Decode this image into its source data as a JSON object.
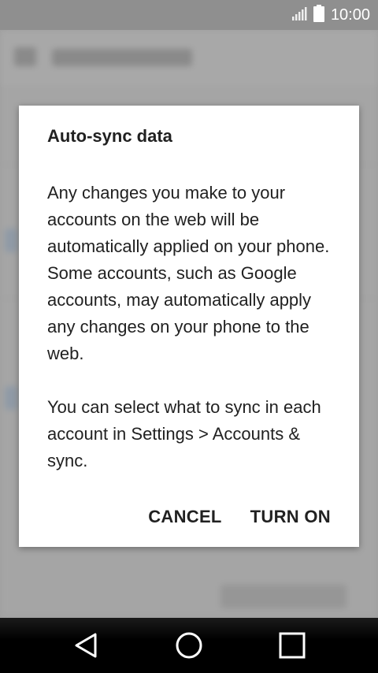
{
  "status_bar": {
    "time": "10:00",
    "icons": [
      "signal-icon",
      "battery-icon"
    ]
  },
  "dialog": {
    "title": "Auto-sync data",
    "paragraph_1": "Any changes you make to your accounts on the web will be automatically applied on your phone. Some accounts, such as Google accounts, may automatically apply any changes on your phone to the web.",
    "paragraph_2": "You can select what to sync in each account in Settings > Accounts & sync.",
    "cancel_label": "CANCEL",
    "confirm_label": "TURN ON"
  },
  "nav_bar": {
    "icons": [
      "back-icon",
      "home-icon",
      "recents-icon"
    ]
  },
  "colors": {
    "scrim": "#9e9e9e",
    "dialog_background": "#ffffff",
    "text": "#212121",
    "nav_bar": "#000000"
  }
}
